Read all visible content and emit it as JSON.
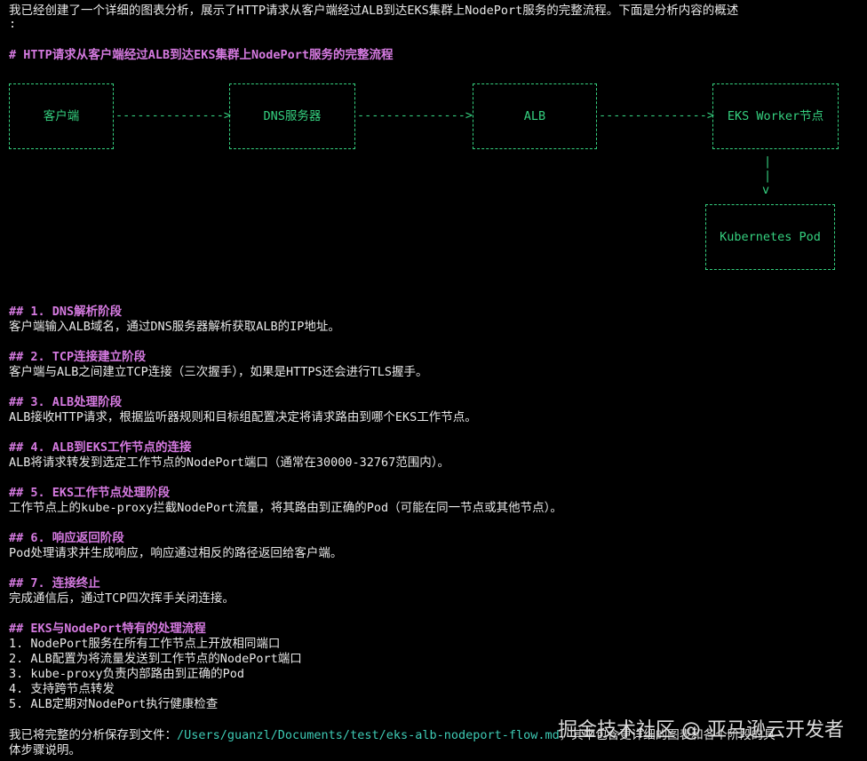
{
  "intro": {
    "line1": "我已经创建了一个详细的图表分析，展示了HTTP请求从客户端经过ALB到达EKS集群上NodePort服务的完整流程。下面是分析内容的概述",
    "line2": ":"
  },
  "main_title": "# HTTP请求从客户端经过ALB到达EKS集群上NodePort服务的完整流程",
  "diagram": {
    "boxes": [
      "客户端",
      "DNS服务器",
      "ALB",
      "EKS Worker节点",
      "Kubernetes Pod"
    ],
    "arrow_down": "v"
  },
  "sections": [
    {
      "heading": "## 1. DNS解析阶段",
      "body": "客户端输入ALB域名，通过DNS服务器解析获取ALB的IP地址。"
    },
    {
      "heading": "## 2. TCP连接建立阶段",
      "body": "客户端与ALB之间建立TCP连接（三次握手），如果是HTTPS还会进行TLS握手。"
    },
    {
      "heading": "## 3. ALB处理阶段",
      "body": "ALB接收HTTP请求，根据监听器规则和目标组配置决定将请求路由到哪个EKS工作节点。"
    },
    {
      "heading": "## 4. ALB到EKS工作节点的连接",
      "body": "ALB将请求转发到选定工作节点的NodePort端口（通常在30000-32767范围内）。"
    },
    {
      "heading": "## 5. EKS工作节点处理阶段",
      "body": "工作节点上的kube-proxy拦截NodePort流量，将其路由到正确的Pod（可能在同一节点或其他节点）。"
    },
    {
      "heading": "## 6. 响应返回阶段",
      "body": "Pod处理请求并生成响应，响应通过相反的路径返回给客户端。"
    },
    {
      "heading": "## 7. 连接终止",
      "body": "完成通信后，通过TCP四次挥手关闭连接。"
    }
  ],
  "special": {
    "heading": "## EKS与NodePort特有的处理流程",
    "items": [
      "1. NodePort服务在所有工作节点上开放相同端口",
      "2. ALB配置为将流量发送到工作节点的NodePort端口",
      "3. kube-proxy负责内部路由到正确的Pod",
      "4. 支持跨节点转发",
      "5. ALB定期对NodePort执行健康检查"
    ]
  },
  "footer": {
    "prefix": "我已将完整的分析保存到文件：",
    "path": "/Users/guanzl/Documents/test/eks-alb-nodeport-flow.md",
    "suffix": "，其中包含更详细的图表和各个阶段的具",
    "line2": "体步骤说明。"
  },
  "watermark": "掘金技术社区 @ 亚马逊云开发者",
  "colors": {
    "background": "#000000",
    "heading": "#d57ae0",
    "diagram": "#35d07f",
    "path": "#3ecbb5",
    "text": "#e8e8e8"
  }
}
